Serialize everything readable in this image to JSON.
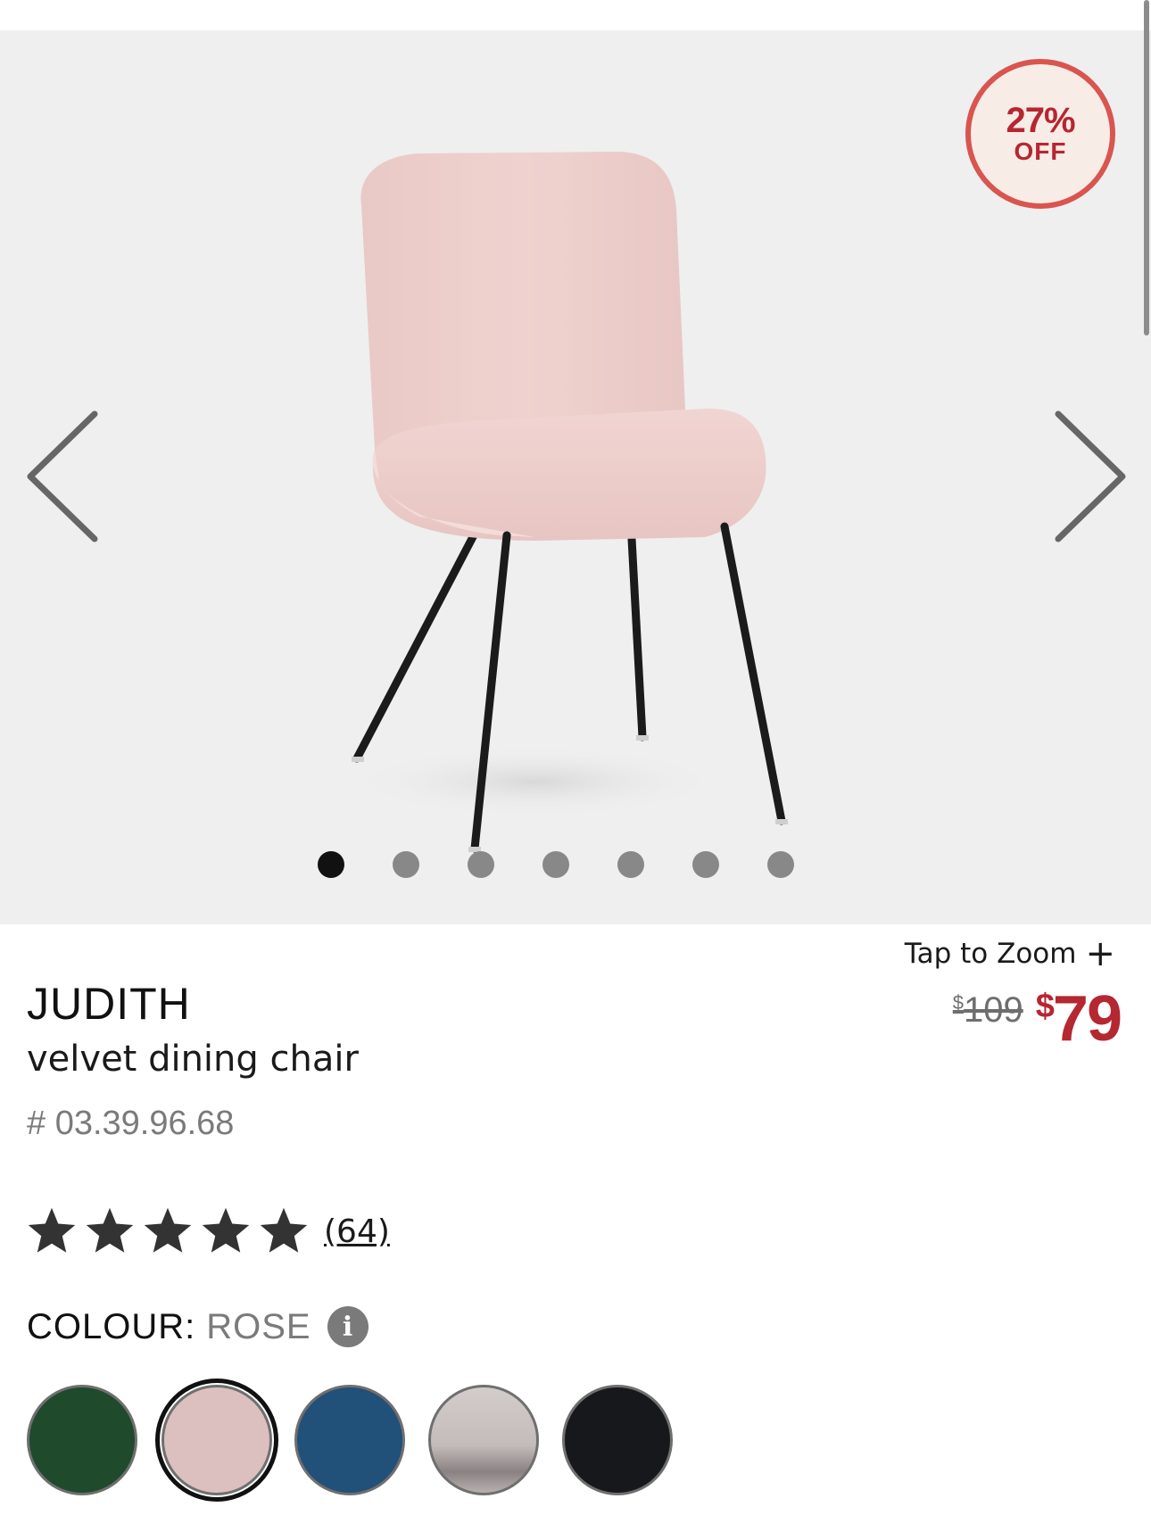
{
  "badge": {
    "percent": "27%",
    "label": "OFF"
  },
  "gallery": {
    "image_count": 7,
    "active_index": 0
  },
  "zoom": {
    "label": "Tap to Zoom",
    "plus": "+"
  },
  "price": {
    "currency": "$",
    "original": "109",
    "sale": "79"
  },
  "product": {
    "name": "JUDITH",
    "description": "velvet dining chair",
    "sku": "# 03.39.96.68"
  },
  "rating": {
    "stars": 5,
    "reviews": "(64)"
  },
  "colour": {
    "label": "COLOUR:",
    "selected": "ROSE",
    "info_icon": "i",
    "swatches": [
      {
        "name": "green",
        "color": "#1f4a2c"
      },
      {
        "name": "rose",
        "color": "#dcbfbf"
      },
      {
        "name": "blue",
        "color": "#215079"
      },
      {
        "name": "grey",
        "color": "#bfb7b5"
      },
      {
        "name": "black",
        "color": "#17181b"
      }
    ]
  }
}
